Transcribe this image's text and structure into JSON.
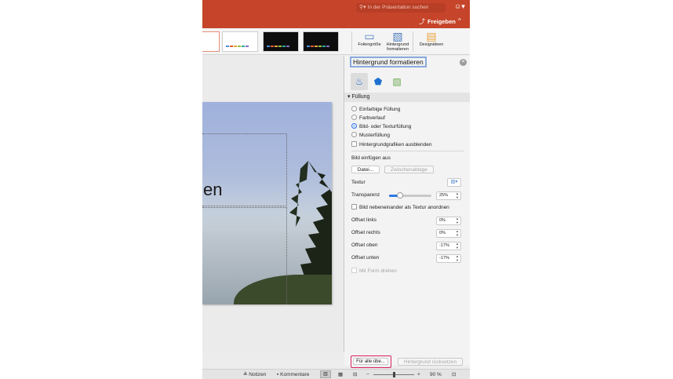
{
  "titlebar": {
    "search_placeholder": "In der Präsentation suchen",
    "search_icon": "search-icon",
    "smiley_icon": "smiley-feedback-icon",
    "share_label": "Freigeben",
    "share_icon": "share-icon",
    "collapse_icon": "chevron-up-icon",
    "accent_color": "#c6452a"
  },
  "ribbon": {
    "slide_size_label": "Foliengröße",
    "format_background_label": "Hintergrund formatieren",
    "design_ideas_label": "Designideen"
  },
  "slide": {
    "title_fragment": "en"
  },
  "pane": {
    "title": "Hintergrund formatieren",
    "close_icon": "close-icon",
    "tabs": [
      {
        "name": "fill-line-tab",
        "icon": "paint-bucket-icon"
      },
      {
        "name": "effects-tab",
        "icon": "pentagon-icon"
      },
      {
        "name": "picture-tab",
        "icon": "picture-icon"
      }
    ],
    "section_title": "Füllung",
    "fill_options": [
      "Einfarbige Füllung",
      "Farbverlauf",
      "Bild- oder Texturfüllung",
      "Musterfüllung"
    ],
    "fill_selected": "Bild- oder Texturfüllung",
    "hide_graphics_label": "Hintergrundgrafiken ausblenden",
    "insert_from_label": "Bild einfügen aus",
    "file_button": "Datei...",
    "clipboard_button": "Zwischenablage",
    "texture_label": "Textur",
    "transparency_label": "Transparenz",
    "transparency_value": "25%",
    "transparency_fraction": 0.25,
    "tile_label": "Bild nebeneinander als Textur anordnen",
    "offset_left_label": "Offset links",
    "offset_left_value": "0%",
    "offset_right_label": "Offset rechts",
    "offset_right_value": "0%",
    "offset_top_label": "Offset oben",
    "offset_top_value": "-17%",
    "offset_bottom_label": "Offset unten",
    "offset_bottom_value": "-17%",
    "rotate_with_shape_label": "Mit Form drehen",
    "apply_all_button": "Für alle übe...",
    "reset_button": "Hintergrund rücksetzen"
  },
  "statusbar": {
    "notes_label": "Notizen",
    "comments_label": "Kommentare",
    "zoom_value": "90 %",
    "zoom_fraction": 0.5
  }
}
